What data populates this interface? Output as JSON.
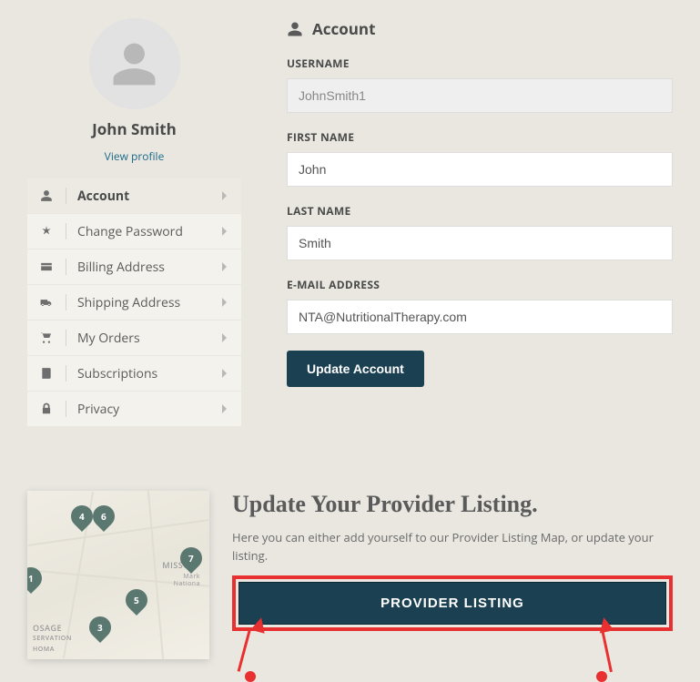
{
  "profile": {
    "name": "John Smith",
    "view_profile_label": "View profile"
  },
  "nav": [
    {
      "label": "Account",
      "icon": "user",
      "active": true
    },
    {
      "label": "Change Password",
      "icon": "asterisk",
      "active": false
    },
    {
      "label": "Billing Address",
      "icon": "card",
      "active": false
    },
    {
      "label": "Shipping Address",
      "icon": "truck",
      "active": false
    },
    {
      "label": "My Orders",
      "icon": "cart",
      "active": false
    },
    {
      "label": "Subscriptions",
      "icon": "book",
      "active": false
    },
    {
      "label": "Privacy",
      "icon": "lock",
      "active": false
    }
  ],
  "account": {
    "heading": "Account",
    "fields": {
      "username": {
        "label": "USERNAME",
        "value": "JohnSmith1",
        "disabled": true
      },
      "first_name": {
        "label": "FIRST NAME",
        "value": "John",
        "disabled": false
      },
      "last_name": {
        "label": "LAST NAME",
        "value": "Smith",
        "disabled": false
      },
      "email": {
        "label": "E-MAIL ADDRESS",
        "value": "NTA@NutritionalTherapy.com",
        "disabled": false
      }
    },
    "submit_label": "Update Account"
  },
  "listing": {
    "title": "Update Your Provider Listing.",
    "description": "Here you can either add yourself to our Provider Listing Map, or update your listing.",
    "button_label": "PROVIDER LISTING"
  },
  "map": {
    "pins": [
      {
        "n": "1",
        "pos": "p1"
      },
      {
        "n": "3",
        "pos": "p2"
      },
      {
        "n": "4",
        "pos": "p3"
      },
      {
        "n": "5",
        "pos": "p4"
      },
      {
        "n": "6",
        "pos": "p5"
      },
      {
        "n": "7",
        "pos": "p6"
      }
    ],
    "labels": {
      "missouri": "MISSOU",
      "mark": "Mark",
      "national": "Nationa",
      "osage": "OSAGE",
      "servation": "SERVATION",
      "homa": "HOMA"
    }
  }
}
